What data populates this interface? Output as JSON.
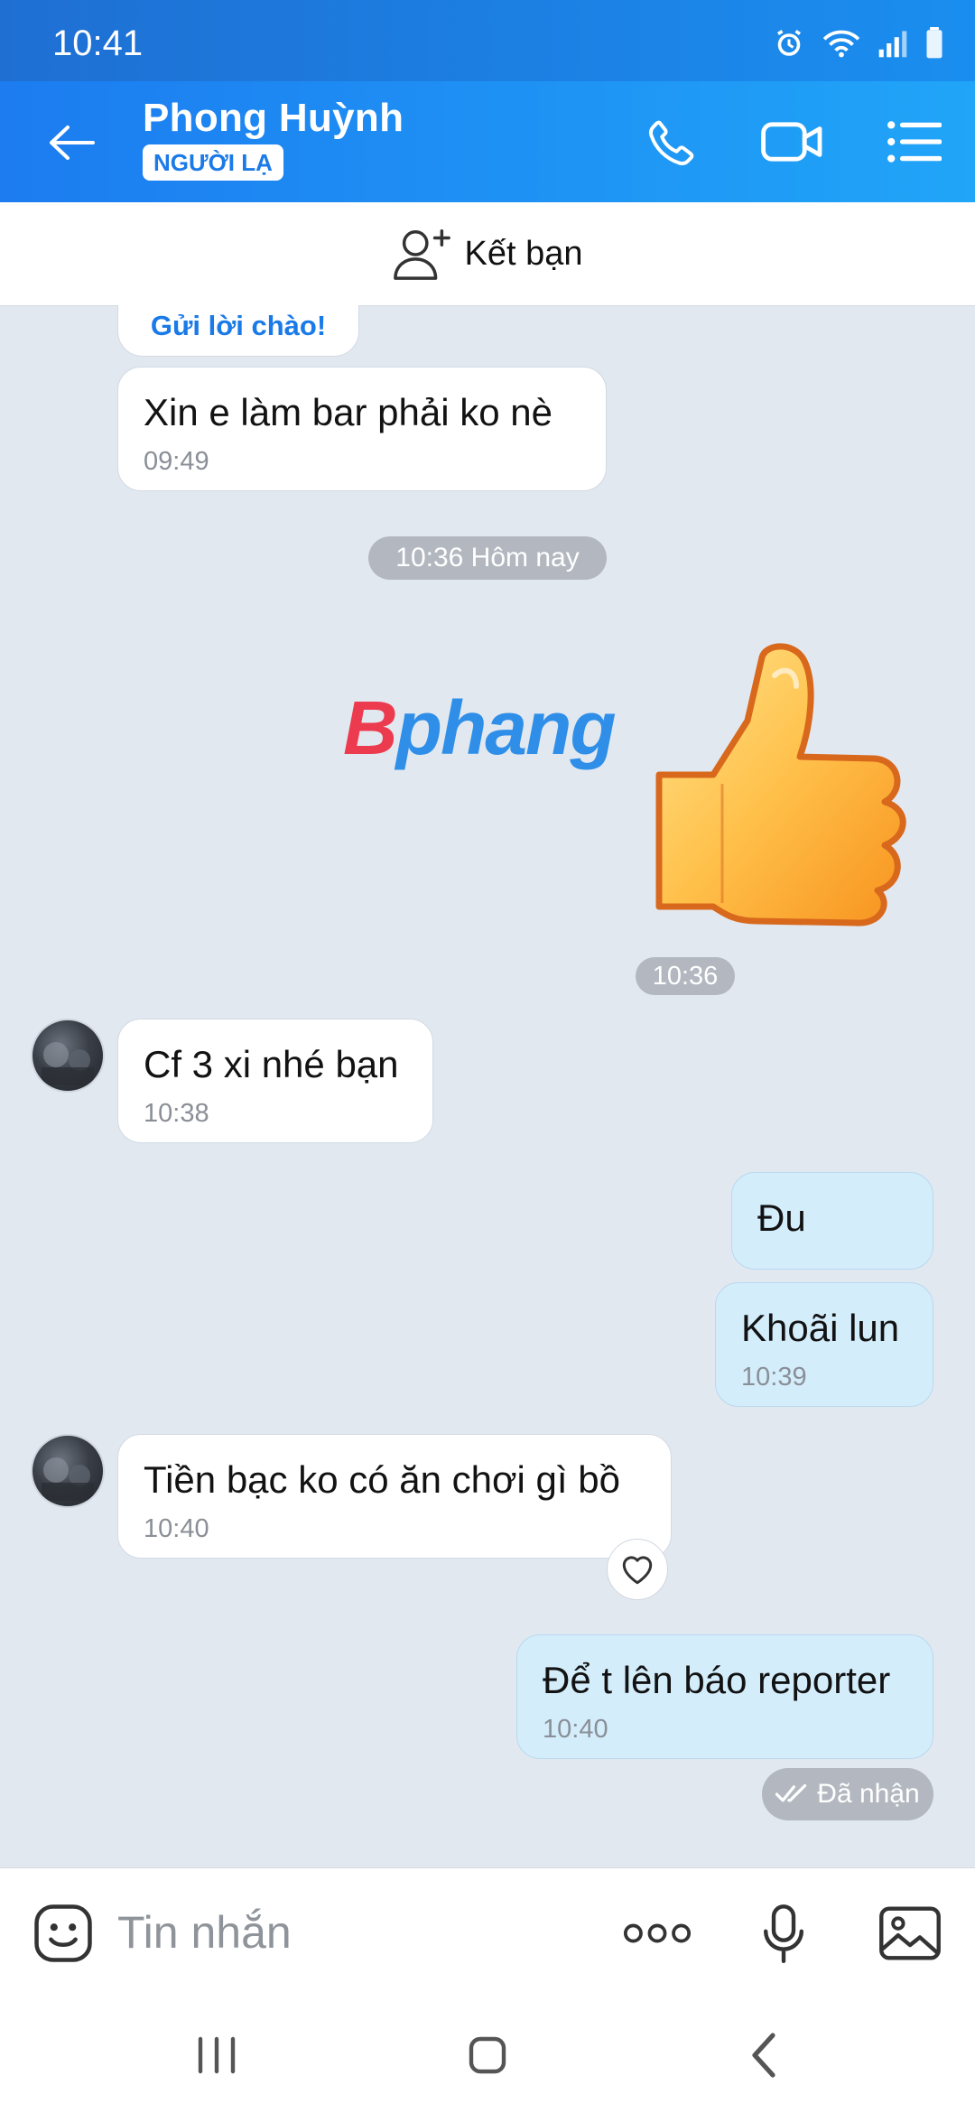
{
  "status_bar": {
    "time": "10:41"
  },
  "header": {
    "contact_name": "Phong Huỳnh",
    "badge": "NGƯỜI LẠ"
  },
  "add_friend": {
    "label": "Kết bạn"
  },
  "messages": {
    "greeting_label": "Gửi lời chào!",
    "m1_text": "Xin e  làm bar phải ko nè",
    "m1_time": "09:49",
    "date_separator": "10:36 Hôm nay",
    "sticker_time": "10:36",
    "m2_text": "Cf 3 xi nhé bạn",
    "m2_time": "10:38",
    "m3_text": "Đu",
    "m4_text": "Khoãi lun",
    "m4_time": "10:39",
    "m5_text": "Tiền bạc ko có ăn chơi gì bồ",
    "m5_time": "10:40",
    "m6_text": "Để t lên báo reporter",
    "m6_time": "10:40",
    "delivery_status": "Đã nhận"
  },
  "watermark": {
    "part1": "B",
    "part2": "phang"
  },
  "composer": {
    "placeholder": "Tin nhắn"
  },
  "colors": {
    "header_blue": "#1c7cf0",
    "outgoing_bubble": "#d4edfb",
    "chat_background": "#e2e8f0",
    "accent": "#1a7ae8"
  }
}
